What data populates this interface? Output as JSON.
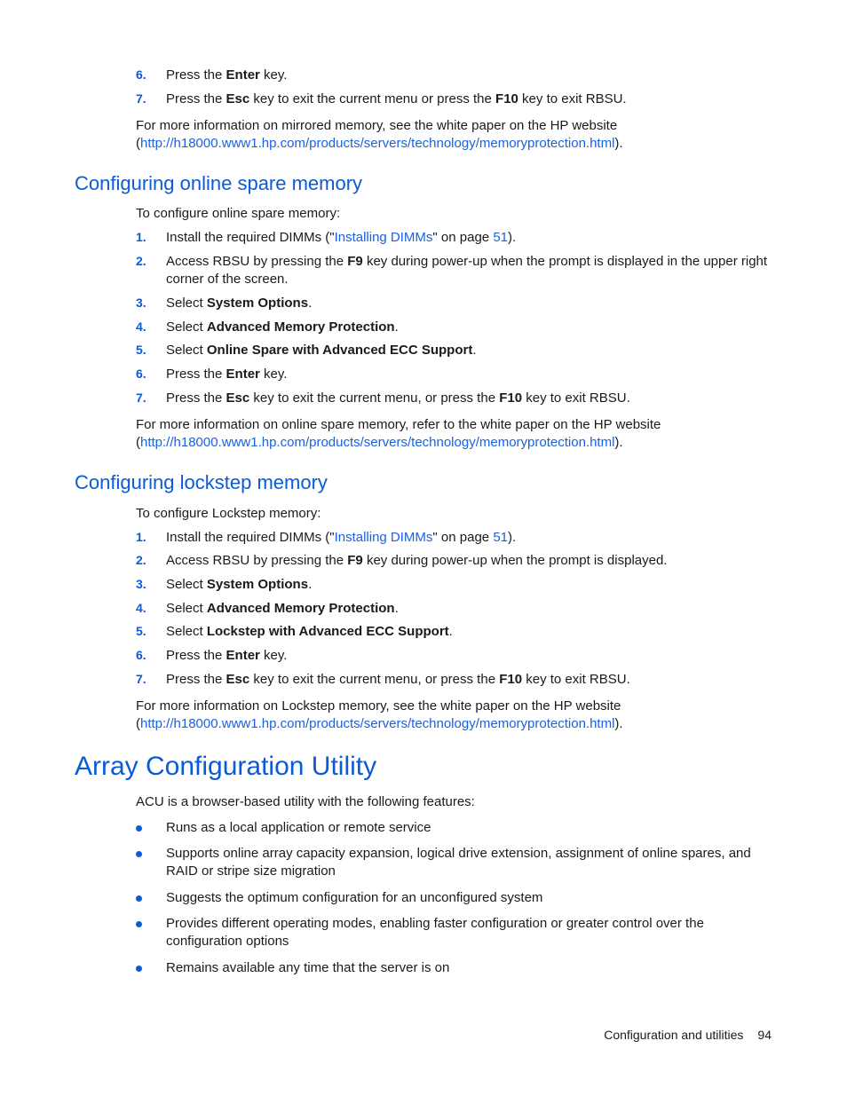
{
  "top_steps": [
    {
      "num": "6.",
      "pre": "Press the ",
      "bold": "Enter",
      "post": " key."
    },
    {
      "num": "7.",
      "pre": "Press the ",
      "bold": "Esc",
      "mid": " key to exit the current menu or press the ",
      "bold2": "F10",
      "post": " key to exit RBSU."
    }
  ],
  "top_more_info": {
    "line1": "For more information on mirrored memory, see the white paper on the HP website",
    "open": "(",
    "url": "http://h18000.www1.hp.com/products/servers/technology/memoryprotection.html",
    "close": ")."
  },
  "online_spare": {
    "heading": "Configuring online spare memory",
    "intro": "To configure online spare memory:",
    "step1": {
      "num": "1.",
      "pre": "Install the required DIMMs (\"",
      "link": "Installing DIMMs",
      "mid": "\" on page ",
      "page_link": "51",
      "post": ")."
    },
    "step2": {
      "num": "2.",
      "pre": "Access RBSU by pressing the ",
      "bold": "F9",
      "post": " key during power-up when the prompt is displayed in the upper right",
      "line2": "corner of the screen."
    },
    "step3": {
      "num": "3.",
      "pre": "Select ",
      "bold": "System Options",
      "post": "."
    },
    "step4": {
      "num": "4.",
      "pre": "Select ",
      "bold": "Advanced Memory Protection",
      "post": "."
    },
    "step5": {
      "num": "5.",
      "pre": "Select ",
      "bold": "Online Spare with Advanced ECC Support",
      "post": "."
    },
    "step6": {
      "num": "6.",
      "pre": "Press the ",
      "bold": "Enter",
      "post": " key."
    },
    "step7": {
      "num": "7.",
      "pre": "Press the ",
      "bold": "Esc",
      "mid": " key to exit the current menu, or press the ",
      "bold2": "F10",
      "post": " key to exit RBSU."
    },
    "more_info": {
      "line1": "For more information on online spare memory, refer to the white paper on the HP website",
      "open": "(",
      "url": "http://h18000.www1.hp.com/products/servers/technology/memoryprotection.html",
      "close": ")."
    }
  },
  "lockstep": {
    "heading": "Configuring lockstep memory",
    "intro": "To configure Lockstep memory:",
    "step1": {
      "num": "1.",
      "pre": "Install the required DIMMs (\"",
      "link": "Installing DIMMs",
      "mid": "\" on page ",
      "page_link": "51",
      "post": ")."
    },
    "step2": {
      "num": "2.",
      "pre": "Access RBSU by pressing the ",
      "bold": "F9",
      "post": " key during power-up when the prompt is displayed."
    },
    "step3": {
      "num": "3.",
      "pre": "Select ",
      "bold": "System Options",
      "post": "."
    },
    "step4": {
      "num": "4.",
      "pre": "Select ",
      "bold": "Advanced Memory Protection",
      "post": "."
    },
    "step5": {
      "num": "5.",
      "pre": "Select ",
      "bold": "Lockstep with Advanced ECC Support",
      "post": "."
    },
    "step6": {
      "num": "6.",
      "pre": "Press the ",
      "bold": "Enter",
      "post": " key."
    },
    "step7": {
      "num": "7.",
      "pre": "Press the ",
      "bold": "Esc",
      "mid": " key to exit the current menu, or press the ",
      "bold2": "F10",
      "post": " key to exit RBSU."
    },
    "more_info": {
      "line1": "For more information on Lockstep memory, see the white paper on the HP website",
      "open": "(",
      "url": "http://h18000.www1.hp.com/products/servers/technology/memoryprotection.html",
      "close": ")."
    }
  },
  "acu": {
    "heading": "Array Configuration Utility",
    "intro": "ACU is a browser-based utility with the following features:",
    "bullets": [
      {
        "line1": "Runs as a local application or remote service"
      },
      {
        "line1": "Supports online array capacity expansion, logical drive extension, assignment of online spares, and",
        "line2": "RAID or stripe size migration"
      },
      {
        "line1": "Suggests the optimum configuration for an unconfigured system"
      },
      {
        "line1": "Provides different operating modes, enabling faster configuration or greater control over the",
        "line2": "configuration options"
      },
      {
        "line1": "Remains available any time that the server is on"
      }
    ]
  },
  "footer": {
    "section": "Configuration and utilities",
    "page_number": "94"
  },
  "colors": {
    "accent": "#0a5bd6",
    "link": "#1a62e0",
    "text": "#1a1a1a"
  }
}
